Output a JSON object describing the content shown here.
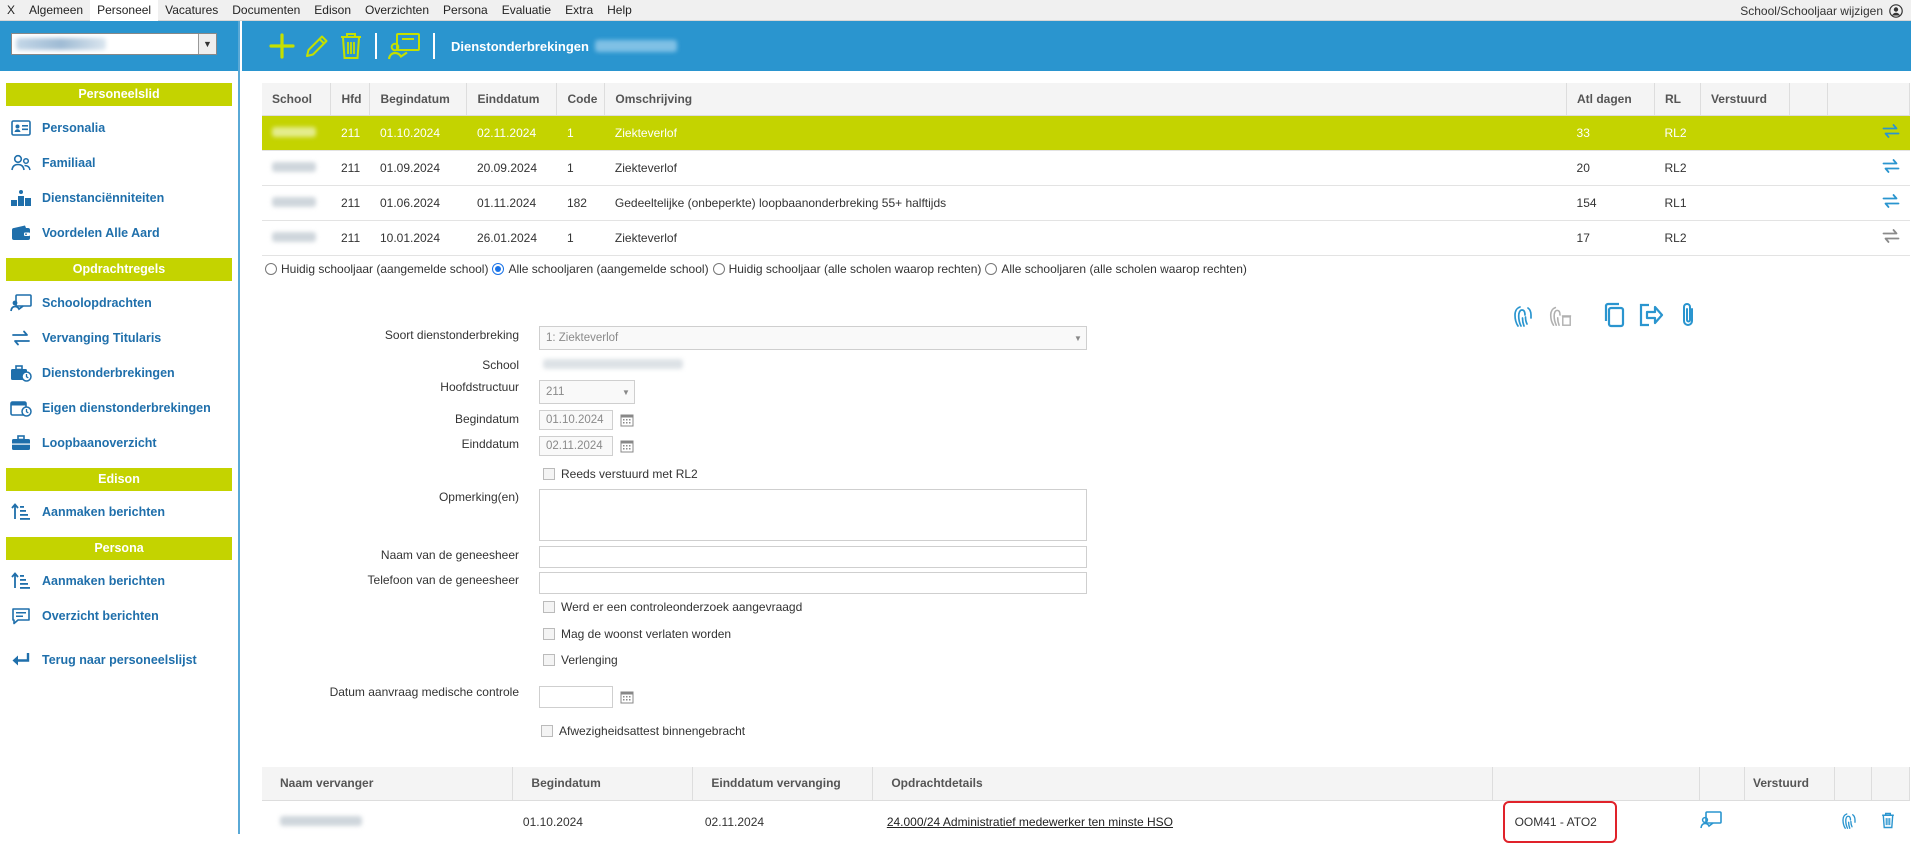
{
  "menubar": {
    "items": [
      {
        "label": "X"
      },
      {
        "label": "Algemeen"
      },
      {
        "label": "Personeel",
        "active": true
      },
      {
        "label": "Vacatures"
      },
      {
        "label": "Documenten"
      },
      {
        "label": "Edison"
      },
      {
        "label": "Overzichten"
      },
      {
        "label": "Persona"
      },
      {
        "label": "Evaluatie"
      },
      {
        "label": "Extra"
      },
      {
        "label": "Help"
      }
    ],
    "right_label": "School/Schooljaar wijzigen"
  },
  "sidebar": {
    "sections": [
      {
        "header": "Personeelslid",
        "items": [
          "Personalia",
          "Familiaal",
          "Dienstanciënniteiten",
          "Voordelen Alle Aard"
        ]
      },
      {
        "header": "Opdrachtregels",
        "items": [
          "Schoolopdrachten",
          "Vervanging Titularis",
          "Dienstonderbrekingen",
          "Eigen dienstonderbrekingen",
          "Loopbaanoverzicht"
        ]
      },
      {
        "header": "Edison",
        "items": [
          "Aanmaken berichten"
        ]
      },
      {
        "header": "Persona",
        "items": [
          "Aanmaken berichten",
          "Overzicht berichten"
        ]
      }
    ],
    "back_label": "Terug naar personeelslijst"
  },
  "toolbar": {
    "title": "Dienstonderbrekingen"
  },
  "grid": {
    "columns": [
      "School",
      "Hfd",
      "Begindatum",
      "Einddatum",
      "Code",
      "Omschrijving",
      "Atl dagen",
      "RL",
      "Verstuurd",
      "",
      ""
    ],
    "rows": [
      {
        "hfd": "211",
        "begin": "01.10.2024",
        "eind": "02.11.2024",
        "code": "1",
        "omschrijving": "Ziekteverlof",
        "atl": "33",
        "rl": "RL2",
        "selected": true
      },
      {
        "hfd": "211",
        "begin": "01.09.2024",
        "eind": "20.09.2024",
        "code": "1",
        "omschrijving": "Ziekteverlof",
        "atl": "20",
        "rl": "RL2",
        "selected": false
      },
      {
        "hfd": "211",
        "begin": "01.06.2024",
        "eind": "01.11.2024",
        "code": "182",
        "omschrijving": "Gedeeltelijke (onbeperkte) loopbaanonderbreking 55+ halftijds",
        "atl": "154",
        "rl": "RL1",
        "selected": false
      },
      {
        "hfd": "211",
        "begin": "10.01.2024",
        "eind": "26.01.2024",
        "code": "1",
        "omschrijving": "Ziekteverlof",
        "atl": "17",
        "rl": "RL2",
        "selected": false
      }
    ]
  },
  "filter": {
    "options": [
      "Huidig schooljaar (aangemelde school)",
      "Alle schooljaren (aangemelde school)",
      "Huidig schooljaar (alle scholen waarop rechten)",
      "Alle schooljaren (alle scholen waarop rechten)"
    ],
    "selected_index": 1
  },
  "form": {
    "soort_label": "Soort dienstonderbreking",
    "soort_value": "1: Ziekteverlof",
    "school_label": "School",
    "hoofdstructuur_label": "Hoofdstructuur",
    "hoofdstructuur_value": "211",
    "begindatum_label": "Begindatum",
    "begindatum_value": "01.10.2024",
    "einddatum_label": "Einddatum",
    "einddatum_value": "02.11.2024",
    "reeds_verstuurd_label": "Reeds verstuurd met RL2",
    "opmerkingen_label": "Opmerking(en)",
    "naam_geneesheer_label": "Naam van de geneesheer",
    "telefoon_geneesheer_label": "Telefoon van de geneesheer",
    "controleonderzoek_label": "Werd er een controleonderzoek aangevraagd",
    "woonst_label": "Mag de woonst verlaten worden",
    "verlenging_label": "Verlenging",
    "datum_aanvraag_label": "Datum aanvraag medische controle",
    "afwezigheidsattest_label": "Afwezigheidsattest binnengebracht"
  },
  "vervangers": {
    "columns": [
      "Naam vervanger",
      "Begindatum",
      "Einddatum vervanging",
      "Opdrachtdetails",
      "",
      "",
      "Verstuurd",
      "",
      ""
    ],
    "rows": [
      {
        "begin": "01.10.2024",
        "eind": "02.11.2024",
        "details": "24.000/24 Administratief medewerker ten minste HSO",
        "code": "OOM41 - ATO2"
      }
    ]
  },
  "colors": {
    "brand_blue": "#2a95cf",
    "accent_green": "#c4d300",
    "link_blue": "#1f6fab",
    "highlight_red": "#e0222a"
  }
}
